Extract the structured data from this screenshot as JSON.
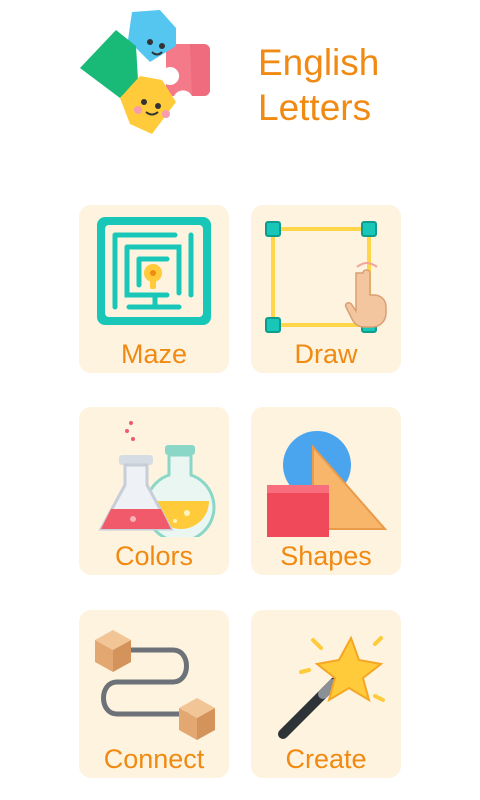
{
  "app": {
    "title_line1": "English",
    "title_line2": "Letters"
  },
  "colors": {
    "accent": "#f08a12",
    "tile_background": "#fdf3df"
  },
  "menu": [
    {
      "label": "Maze",
      "icon": "maze-icon"
    },
    {
      "label": "Draw",
      "icon": "draw-square-icon"
    },
    {
      "label": "Colors",
      "icon": "flasks-icon"
    },
    {
      "label": "Shapes",
      "icon": "shapes-icon"
    },
    {
      "label": "Connect",
      "icon": "connect-boxes-icon"
    },
    {
      "label": "Create",
      "icon": "magic-wand-icon"
    }
  ]
}
